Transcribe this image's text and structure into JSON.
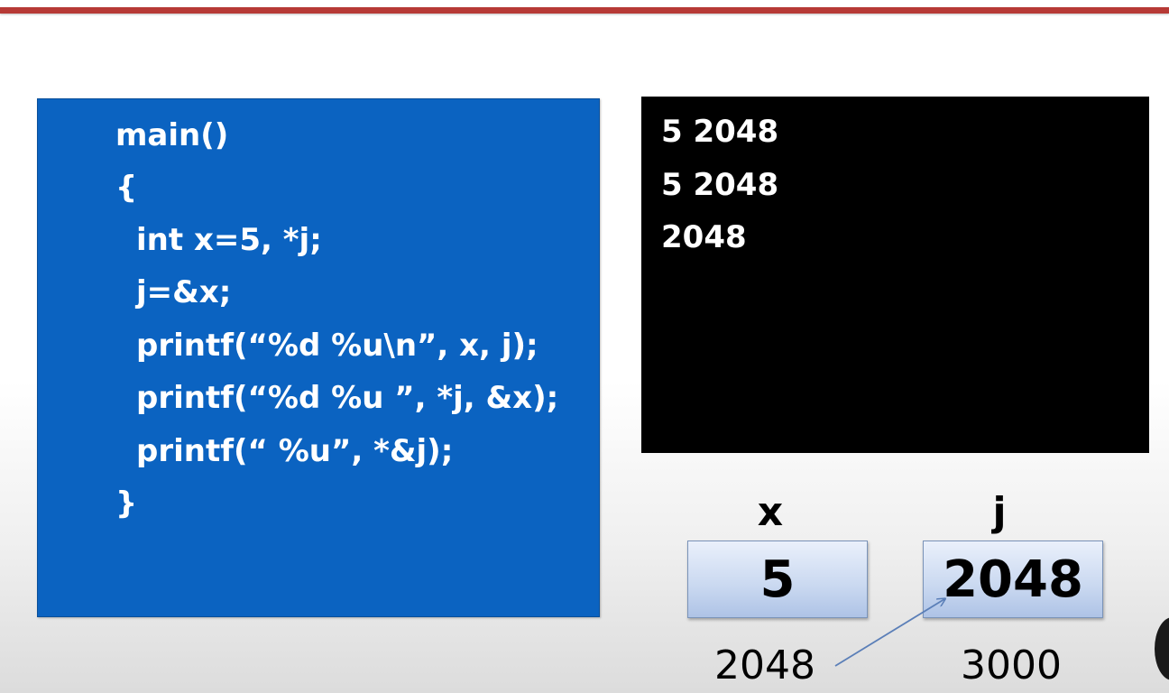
{
  "code": {
    "lines": [
      "main()",
      "{",
      "int x=5, *j;",
      "j=&x;",
      "printf(“%d %u\\n”, x, j);",
      "printf(“%d %u ”, *j, &x);",
      "printf(“ %u”, *&j);",
      "}"
    ]
  },
  "console": {
    "lines": [
      "5 2048",
      "5 2048",
      "2048"
    ]
  },
  "memory": {
    "x": {
      "name": "x",
      "value": "5",
      "address": "2048"
    },
    "j": {
      "name": "j",
      "value": "2048",
      "address": "3000"
    }
  },
  "colors": {
    "code_bg": "#0b63c1",
    "console_bg": "#000000",
    "rule": "#b73a36",
    "box_fill": "#c9d8f0",
    "arrow": "#5b7fb8"
  }
}
